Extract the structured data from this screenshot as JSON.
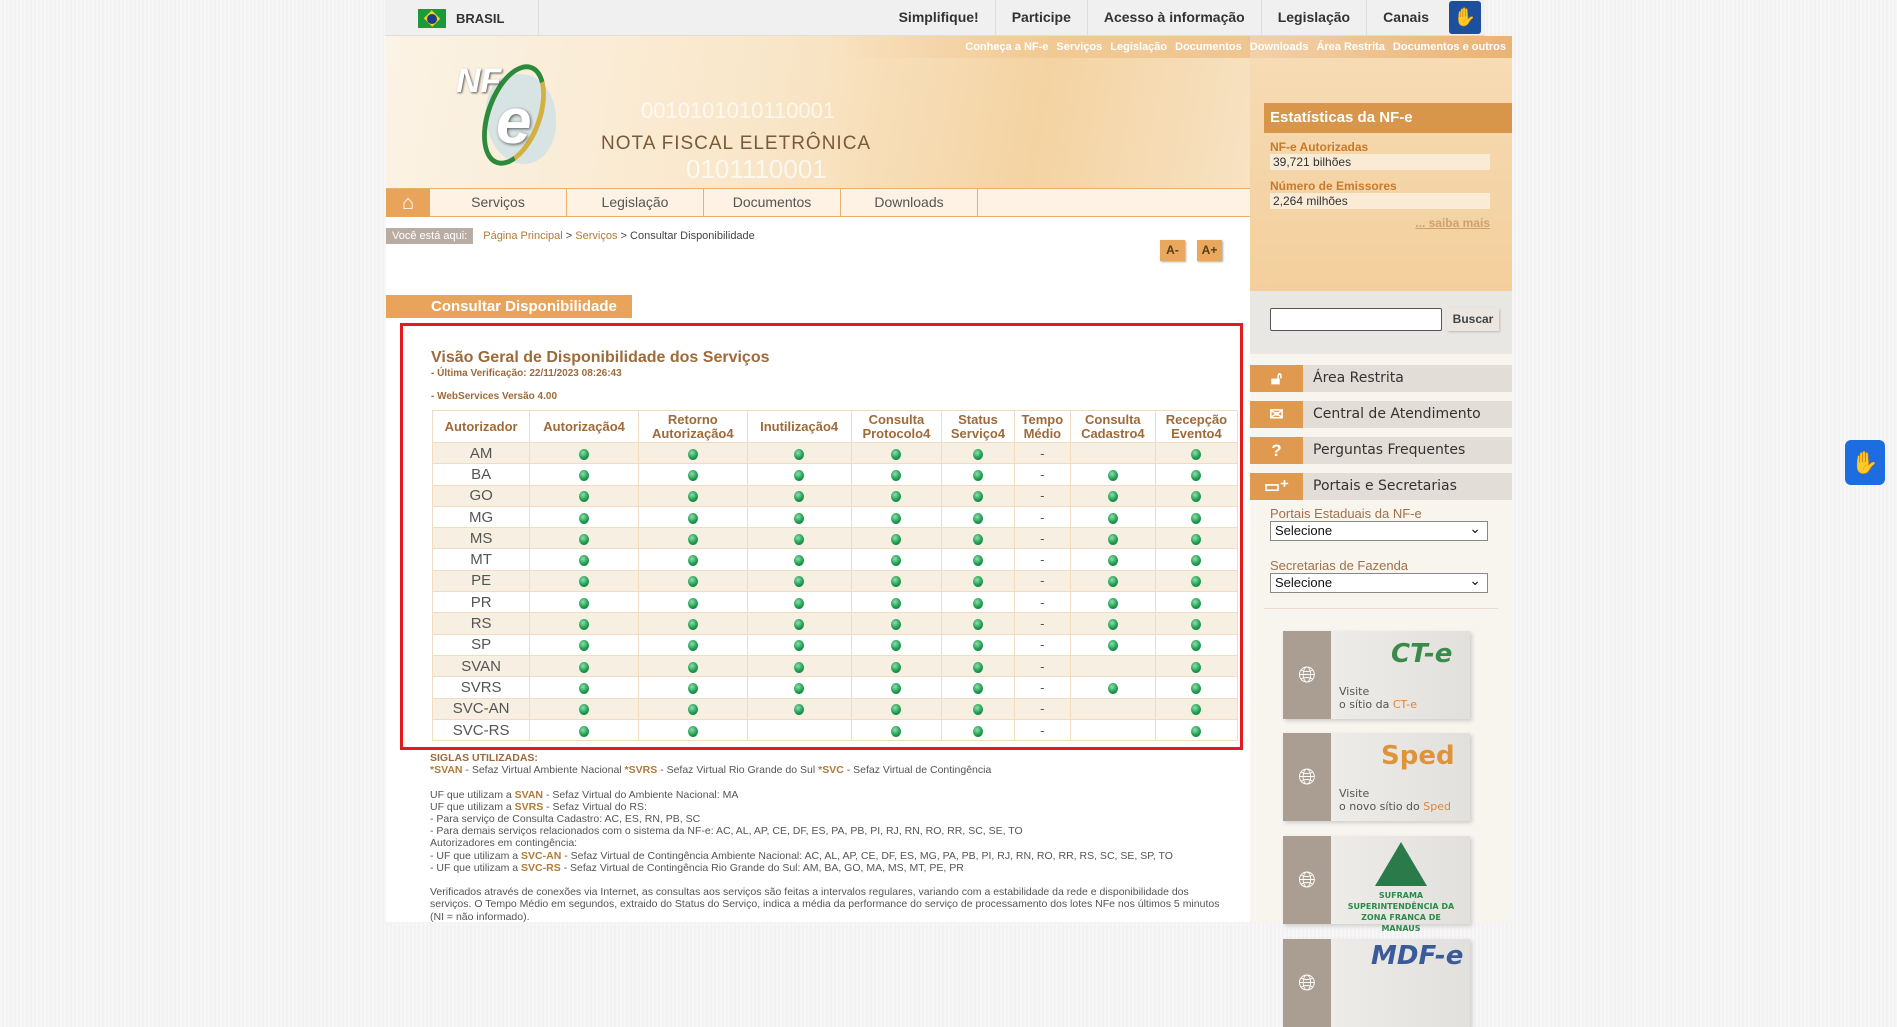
{
  "gov_bar": {
    "country": "BRASIL",
    "menu": [
      "Simplifique!",
      "Participe",
      "Acesso à informação",
      "Legislação",
      "Canais"
    ]
  },
  "top_links": [
    "Conheça a NF-e",
    "Serviços",
    "Legislação",
    "Documentos",
    "Downloads",
    "Área Restrita",
    "Documentos e outros"
  ],
  "banner": {
    "logo": "NF-e",
    "title": "NOTA FISCAL ELETRÔNICA"
  },
  "nav": [
    "Serviços",
    "Legislação",
    "Documentos",
    "Downloads"
  ],
  "breadcrumb": {
    "label": "Você está aqui:",
    "items": [
      "Página Principal",
      "Serviços",
      "Consultar Disponibilidade"
    ],
    "sep": ">"
  },
  "font_buttons": {
    "decrease": "A-",
    "increase": "A+"
  },
  "page_title": "Consultar Disponibilidade",
  "status": {
    "title": "Visão Geral de Disponibilidade dos Serviços",
    "last_check": "- Última Verificação: 22/11/2023 08:26:43",
    "version": "- WebServices Versão 4.00",
    "columns": [
      "Autorizador",
      "Autorização4",
      "Retorno Autorização4",
      "Inutilização4",
      "Consulta Protocolo4",
      "Status Serviço4",
      "Tempo Médio",
      "Consulta Cadastro4",
      "Recepção Evento4"
    ],
    "rows": [
      {
        "aut": "AM",
        "v": [
          1,
          1,
          1,
          1,
          1,
          "-",
          0,
          1
        ]
      },
      {
        "aut": "BA",
        "v": [
          1,
          1,
          1,
          1,
          1,
          "-",
          1,
          1
        ]
      },
      {
        "aut": "GO",
        "v": [
          1,
          1,
          1,
          1,
          1,
          "-",
          1,
          1
        ]
      },
      {
        "aut": "MG",
        "v": [
          1,
          1,
          1,
          1,
          1,
          "-",
          1,
          1
        ]
      },
      {
        "aut": "MS",
        "v": [
          1,
          1,
          1,
          1,
          1,
          "-",
          1,
          1
        ]
      },
      {
        "aut": "MT",
        "v": [
          1,
          1,
          1,
          1,
          1,
          "-",
          1,
          1
        ]
      },
      {
        "aut": "PE",
        "v": [
          1,
          1,
          1,
          1,
          1,
          "-",
          1,
          1
        ]
      },
      {
        "aut": "PR",
        "v": [
          1,
          1,
          1,
          1,
          1,
          "-",
          1,
          1
        ]
      },
      {
        "aut": "RS",
        "v": [
          1,
          1,
          1,
          1,
          1,
          "-",
          1,
          1
        ]
      },
      {
        "aut": "SP",
        "v": [
          1,
          1,
          1,
          1,
          1,
          "-",
          1,
          1
        ]
      },
      {
        "aut": "SVAN",
        "v": [
          1,
          1,
          1,
          1,
          1,
          "-",
          0,
          1
        ]
      },
      {
        "aut": "SVRS",
        "v": [
          1,
          1,
          1,
          1,
          1,
          "-",
          1,
          1
        ]
      },
      {
        "aut": "SVC-AN",
        "v": [
          1,
          1,
          1,
          1,
          1,
          "-",
          0,
          1
        ]
      },
      {
        "aut": "SVC-RS",
        "v": [
          1,
          1,
          0,
          1,
          1,
          "-",
          0,
          1
        ]
      }
    ],
    "status_color": "#1e9c52"
  },
  "notes": {
    "siglas_title": "SIGLAS UTILIZADAS:",
    "siglas": [
      {
        "k": "*SVAN",
        "t": " - Sefaz Virtual Ambiente Nacional "
      },
      {
        "k": "*SVRS",
        "t": " - Sefaz Virtual Rio Grande do Sul "
      },
      {
        "k": "*SVC",
        "t": " - Sefaz Virtual de Contingência"
      }
    ],
    "lines": [
      {
        "pre": "UF que utilizam a ",
        "k": "SVAN",
        "t": " - Sefaz Virtual do Ambiente Nacional: MA"
      },
      {
        "pre": "UF que utilizam a ",
        "k": "SVRS",
        "t": " - Sefaz Virtual do RS:"
      },
      {
        "pre": "- Para serviço de Consulta Cadastro: AC, ES, RN, PB, SC",
        "k": "",
        "t": ""
      },
      {
        "pre": "- Para demais serviços relacionados com o sistema da NF-e: AC, AL, AP, CE, DF, ES, PA, PB, PI, RJ, RN, RO, RR, SC, SE, TO",
        "k": "",
        "t": ""
      },
      {
        "pre": "Autorizadores em contingência:",
        "k": "",
        "t": ""
      },
      {
        "pre": "- UF que utilizam a ",
        "k": "SVC-AN",
        "t": " - Sefaz Virtual de Contingência Ambiente Nacional: AC, AL, AP, CE, DF, ES, MG, PA, PB, PI, RJ, RN, RO, RR, RS, SC, SE, SP, TO"
      },
      {
        "pre": "- UF que utilizam a ",
        "k": "SVC-RS",
        "t": " - Sefaz Virtual de Contingência Rio Grande do Sul: AM, BA, GO, MA, MS, MT, PE, PR"
      }
    ],
    "footer": "Verificados através de conexões via Internet, as consultas aos serviços são feitas a intervalos regulares, variando com a estabilidade da rede e disponibilidade dos serviços. O Tempo Médio em segundos, extraido do Status do Serviço, indica a média da performance do serviço de processamento dos lotes NFe nos últimos 5 minutos (NI = não informado)."
  },
  "sidebar": {
    "stats_title": "Estatísticas da NF-e",
    "authorized_label": "NF-e Autorizadas",
    "authorized_value": "39,721 bilhões",
    "issuers_label": "Número de Emissores",
    "issuers_value": "2,264 milhões",
    "more": "... saiba mais",
    "search_button": "Buscar",
    "menu": [
      "Área Restrita",
      "Central de Atendimento",
      "Perguntas Frequentes",
      "Portais e Secretarias"
    ],
    "portais_label": "Portais Estaduais da NF-e",
    "portais_value": "Selecione",
    "secretarias_label": "Secretarias de Fazenda",
    "secretarias_value": "Selecione",
    "banners": [
      {
        "logo": "CT-e",
        "line1": "Visite",
        "line2": "o sítio da ",
        "hl": "CT-e"
      },
      {
        "logo": "Sped",
        "line1": "Visite",
        "line2": "o novo sítio do ",
        "hl": "Sped"
      },
      {
        "logo": "SUFRAMA",
        "caption": "SUPERINTENDÊNCIA DA ZONA FRANCA DE MANAUS"
      },
      {
        "logo": "MDF-e"
      }
    ]
  }
}
